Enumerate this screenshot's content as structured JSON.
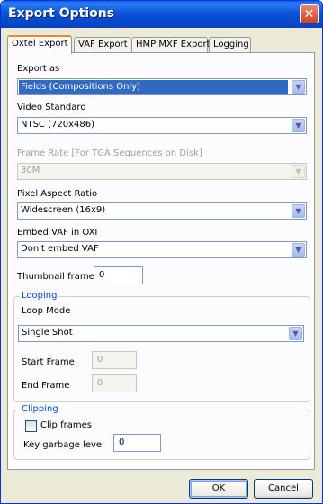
{
  "window": {
    "title": "Export Options",
    "close_glyph": "✕"
  },
  "tabs": [
    {
      "label": "Oxtel Export",
      "active": true
    },
    {
      "label": "VAF Export",
      "active": false
    },
    {
      "label": "HMP MXF Export",
      "active": false
    },
    {
      "label": "Logging",
      "active": false
    }
  ],
  "form": {
    "export_as": {
      "label": "Export as",
      "value": "Fields (Compositions Only)"
    },
    "video_standard": {
      "label": "Video Standard",
      "value": "NTSC (720x486)"
    },
    "frame_rate": {
      "label": "Frame Rate [For TGA Sequences on Disk]",
      "value": "30M",
      "disabled": true
    },
    "pixel_aspect": {
      "label": "Pixel Aspect Ratio",
      "value": "Widescreen (16x9)"
    },
    "embed_vaf": {
      "label": "Embed VAF in OXI",
      "value": "Don't embed VAF"
    },
    "thumbnail_frame": {
      "label": "Thumbnail frame",
      "value": "0"
    }
  },
  "looping": {
    "title": "Looping",
    "loop_mode": {
      "label": "Loop Mode",
      "value": "Single Shot"
    },
    "start_frame": {
      "label": "Start Frame",
      "value": "0",
      "disabled": true
    },
    "end_frame": {
      "label": "End Frame",
      "value": "0",
      "disabled": true
    }
  },
  "clipping": {
    "title": "Clipping",
    "clip_frames": {
      "label": "Clip frames",
      "checked": false
    },
    "key_garbage": {
      "label": "Key garbage level",
      "value": "0"
    }
  },
  "buttons": {
    "ok": "OK",
    "cancel": "Cancel"
  },
  "icons": {
    "dropdown": "chevron-down-icon",
    "close": "close-icon"
  }
}
